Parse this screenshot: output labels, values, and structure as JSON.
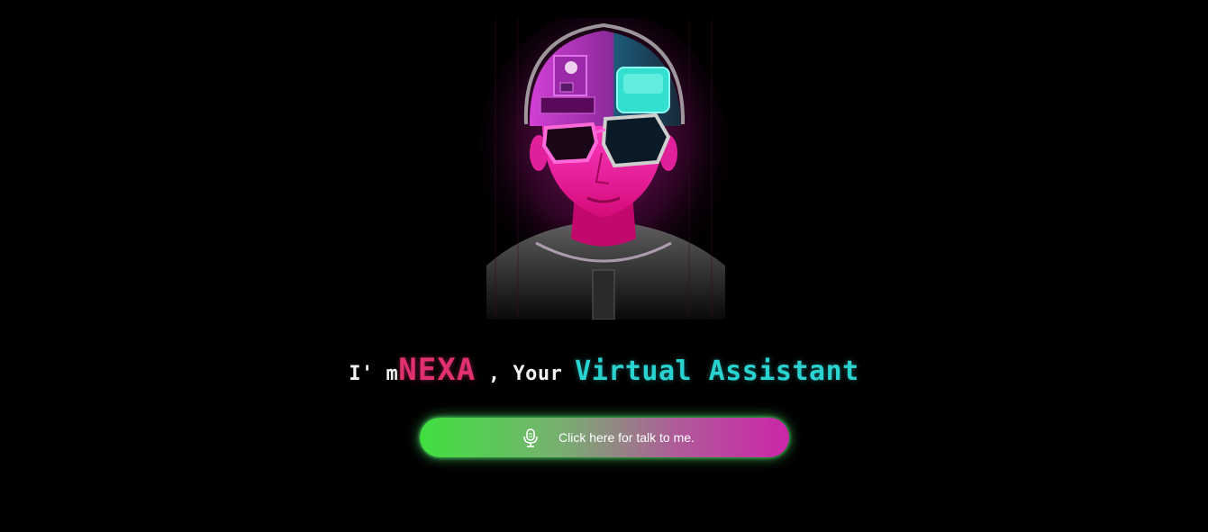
{
  "hero": {
    "avatar_icon": "neon-cyber-avatar"
  },
  "headline": {
    "prefix": "I' m",
    "name": "NEXA",
    "middle": " , Your ",
    "suffix": "Virtual Assistant"
  },
  "talk_button": {
    "label": "Click here for talk to me.",
    "icon": "microphone-icon"
  },
  "colors": {
    "background": "#000000",
    "name_accent": "#e0306f",
    "cyan_accent": "#2ad3cf",
    "button_gradient_start": "#3fe040",
    "button_gradient_end": "#cc25a8"
  }
}
